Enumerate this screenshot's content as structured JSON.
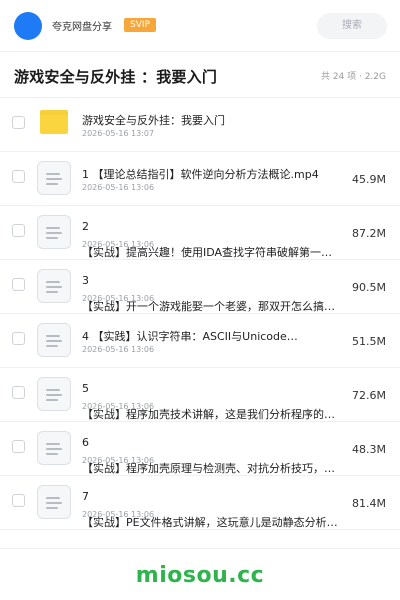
{
  "header": {
    "brand": "夸克网盘分享",
    "badge": "SVIP",
    "search_placeholder": "搜索"
  },
  "folder": {
    "title": "游戏安全与反外挂 ：我要入门",
    "meta": "共 24 项 · 2.2G"
  },
  "items": [
    {
      "type": "folder",
      "name": "游戏安全与反外挂：我要入门",
      "date": "2026-05-16 13:07",
      "size": ""
    },
    {
      "type": "file",
      "name": "1 【理论总结指引】软件逆向分析方法概论.mp4",
      "date": "2026-05-16 13:06",
      "size": "45.9M"
    },
    {
      "type": "file",
      "name": "2",
      "name2": "【实战】提高兴趣！使用IDA查找字符串破解第一…",
      "date": "2026-05-16 13:06",
      "size": "87.2M"
    },
    {
      "type": "file",
      "name": "3",
      "name2": "【实战】开一个游戏能娶一个老婆，那双开怎么搞？…",
      "date": "2026-05-16 13:06",
      "size": "90.5M"
    },
    {
      "type": "file",
      "name": "4 【实践】认识字符串：ASCII与Unicode…",
      "date": "2026-05-16 13:06",
      "size": "51.5M"
    },
    {
      "type": "file",
      "name": "5",
      "name2": "【实战】程序加壳技术讲解，这是我们分析程序的阻…",
      "date": "2026-05-16 13:06",
      "size": "72.6M"
    },
    {
      "type": "file",
      "name": "6",
      "name2": "【实战】程序加壳原理与检测壳、对抗分析技巧，程…",
      "date": "2026-05-16 13:06",
      "size": "48.3M"
    },
    {
      "type": "file",
      "name": "7",
      "name2": "【实战】PE文件格式讲解，这玩意儿是动静态分析…",
      "date": "2026-05-16 13:06",
      "size": "81.4M"
    }
  ],
  "footer": {
    "watermark": "miosou.cc"
  }
}
